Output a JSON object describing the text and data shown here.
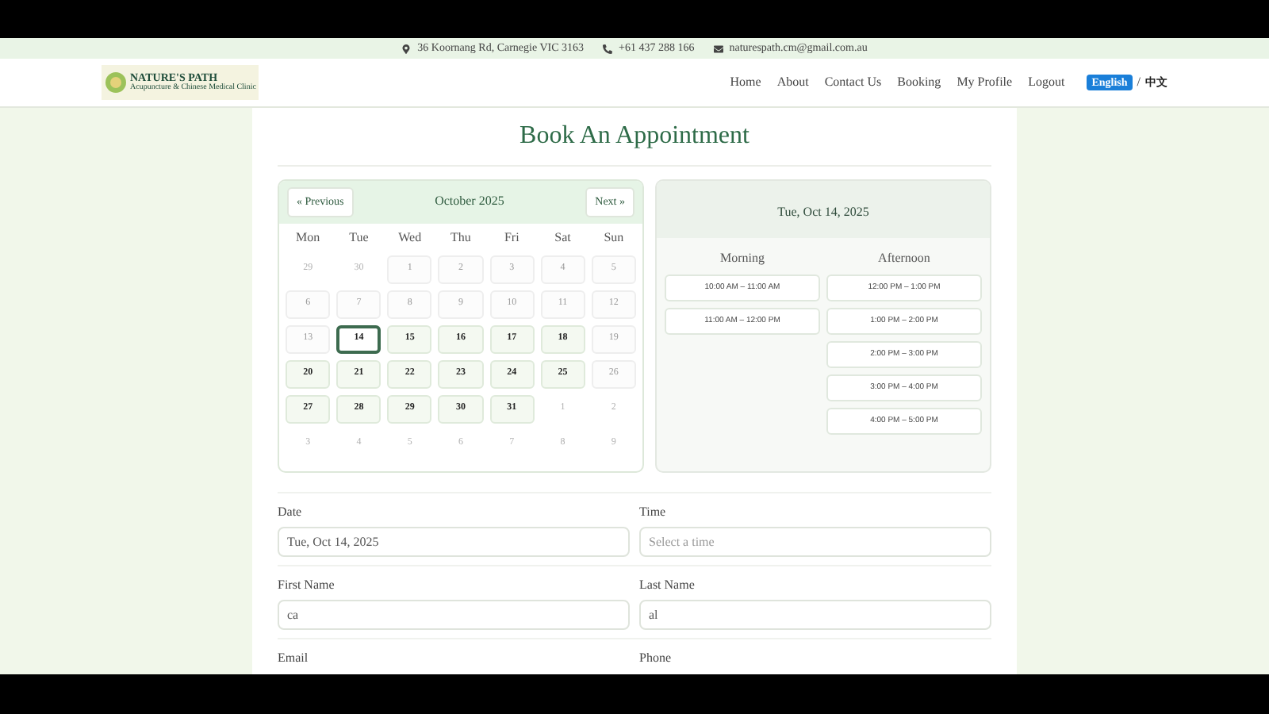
{
  "contact_bar": {
    "address": "36 Koornang Rd, Carnegie VIC 3163",
    "phone": "+61 437 288 166",
    "email": "naturespath.cm@gmail.com.au"
  },
  "logo": {
    "title": "NATURE'S PATH",
    "tagline": "Acupuncture & Chinese Medical Clinic"
  },
  "nav": {
    "items": [
      "Home",
      "About",
      "Contact Us",
      "Booking",
      "My Profile",
      "Logout"
    ],
    "languages": [
      {
        "label": "English",
        "selected": true
      },
      {
        "label": "中文",
        "selected": false
      }
    ],
    "separator": "/"
  },
  "page_title": "Book An Appointment",
  "calendar": {
    "prev": "« Previous",
    "month": "October 2025",
    "next": "Next »",
    "weekdays": [
      "Mon",
      "Tue",
      "Wed",
      "Thu",
      "Fri",
      "Sat",
      "Sun"
    ],
    "days": [
      {
        "label": "29",
        "outside": true,
        "available": false,
        "selected": false
      },
      {
        "label": "30",
        "outside": true,
        "available": false,
        "selected": false
      },
      {
        "label": "1",
        "outside": false,
        "available": false,
        "selected": false
      },
      {
        "label": "2",
        "outside": false,
        "available": false,
        "selected": false
      },
      {
        "label": "3",
        "outside": false,
        "available": false,
        "selected": false
      },
      {
        "label": "4",
        "outside": false,
        "available": false,
        "selected": false
      },
      {
        "label": "5",
        "outside": false,
        "available": false,
        "selected": false
      },
      {
        "label": "6",
        "outside": false,
        "available": false,
        "selected": false
      },
      {
        "label": "7",
        "outside": false,
        "available": false,
        "selected": false
      },
      {
        "label": "8",
        "outside": false,
        "available": false,
        "selected": false
      },
      {
        "label": "9",
        "outside": false,
        "available": false,
        "selected": false
      },
      {
        "label": "10",
        "outside": false,
        "available": false,
        "selected": false
      },
      {
        "label": "11",
        "outside": false,
        "available": false,
        "selected": false
      },
      {
        "label": "12",
        "outside": false,
        "available": false,
        "selected": false
      },
      {
        "label": "13",
        "outside": false,
        "available": false,
        "selected": false
      },
      {
        "label": "14",
        "outside": false,
        "available": true,
        "selected": true
      },
      {
        "label": "15",
        "outside": false,
        "available": true,
        "selected": false
      },
      {
        "label": "16",
        "outside": false,
        "available": true,
        "selected": false
      },
      {
        "label": "17",
        "outside": false,
        "available": true,
        "selected": false
      },
      {
        "label": "18",
        "outside": false,
        "available": true,
        "selected": false
      },
      {
        "label": "19",
        "outside": false,
        "available": false,
        "selected": false
      },
      {
        "label": "20",
        "outside": false,
        "available": true,
        "selected": false
      },
      {
        "label": "21",
        "outside": false,
        "available": true,
        "selected": false
      },
      {
        "label": "22",
        "outside": false,
        "available": true,
        "selected": false
      },
      {
        "label": "23",
        "outside": false,
        "available": true,
        "selected": false
      },
      {
        "label": "24",
        "outside": false,
        "available": true,
        "selected": false
      },
      {
        "label": "25",
        "outside": false,
        "available": true,
        "selected": false
      },
      {
        "label": "26",
        "outside": false,
        "available": false,
        "selected": false
      },
      {
        "label": "27",
        "outside": false,
        "available": true,
        "selected": false
      },
      {
        "label": "28",
        "outside": false,
        "available": true,
        "selected": false
      },
      {
        "label": "29",
        "outside": false,
        "available": true,
        "selected": false
      },
      {
        "label": "30",
        "outside": false,
        "available": true,
        "selected": false
      },
      {
        "label": "31",
        "outside": false,
        "available": true,
        "selected": false
      },
      {
        "label": "1",
        "outside": true,
        "available": false,
        "selected": false
      },
      {
        "label": "2",
        "outside": true,
        "available": false,
        "selected": false
      },
      {
        "label": "3",
        "outside": true,
        "available": false,
        "selected": false
      },
      {
        "label": "4",
        "outside": true,
        "available": false,
        "selected": false
      },
      {
        "label": "5",
        "outside": true,
        "available": false,
        "selected": false
      },
      {
        "label": "6",
        "outside": true,
        "available": false,
        "selected": false
      },
      {
        "label": "7",
        "outside": true,
        "available": false,
        "selected": false
      },
      {
        "label": "8",
        "outside": true,
        "available": false,
        "selected": false
      },
      {
        "label": "9",
        "outside": true,
        "available": false,
        "selected": false
      }
    ]
  },
  "slots": {
    "date": "Tue, Oct 14, 2025",
    "columns": [
      {
        "title": "Morning",
        "slots": [
          "10:00 AM – 11:00 AM",
          "11:00 AM – 12:00 PM"
        ]
      },
      {
        "title": "Afternoon",
        "slots": [
          "12:00 PM – 1:00 PM",
          "1:00 PM – 2:00 PM",
          "2:00 PM – 3:00 PM",
          "3:00 PM – 4:00 PM",
          "4:00 PM – 5:00 PM"
        ]
      }
    ]
  },
  "form": {
    "rows": [
      [
        {
          "label": "Date",
          "value": "Tue, Oct 14, 2025"
        },
        {
          "label": "Time",
          "placeholder": "Select a time"
        }
      ],
      [
        {
          "label": "First Name",
          "value": "ca"
        },
        {
          "label": "Last Name",
          "value": "al"
        }
      ],
      [
        {
          "label": "Email"
        },
        {
          "label": "Phone"
        }
      ]
    ]
  }
}
